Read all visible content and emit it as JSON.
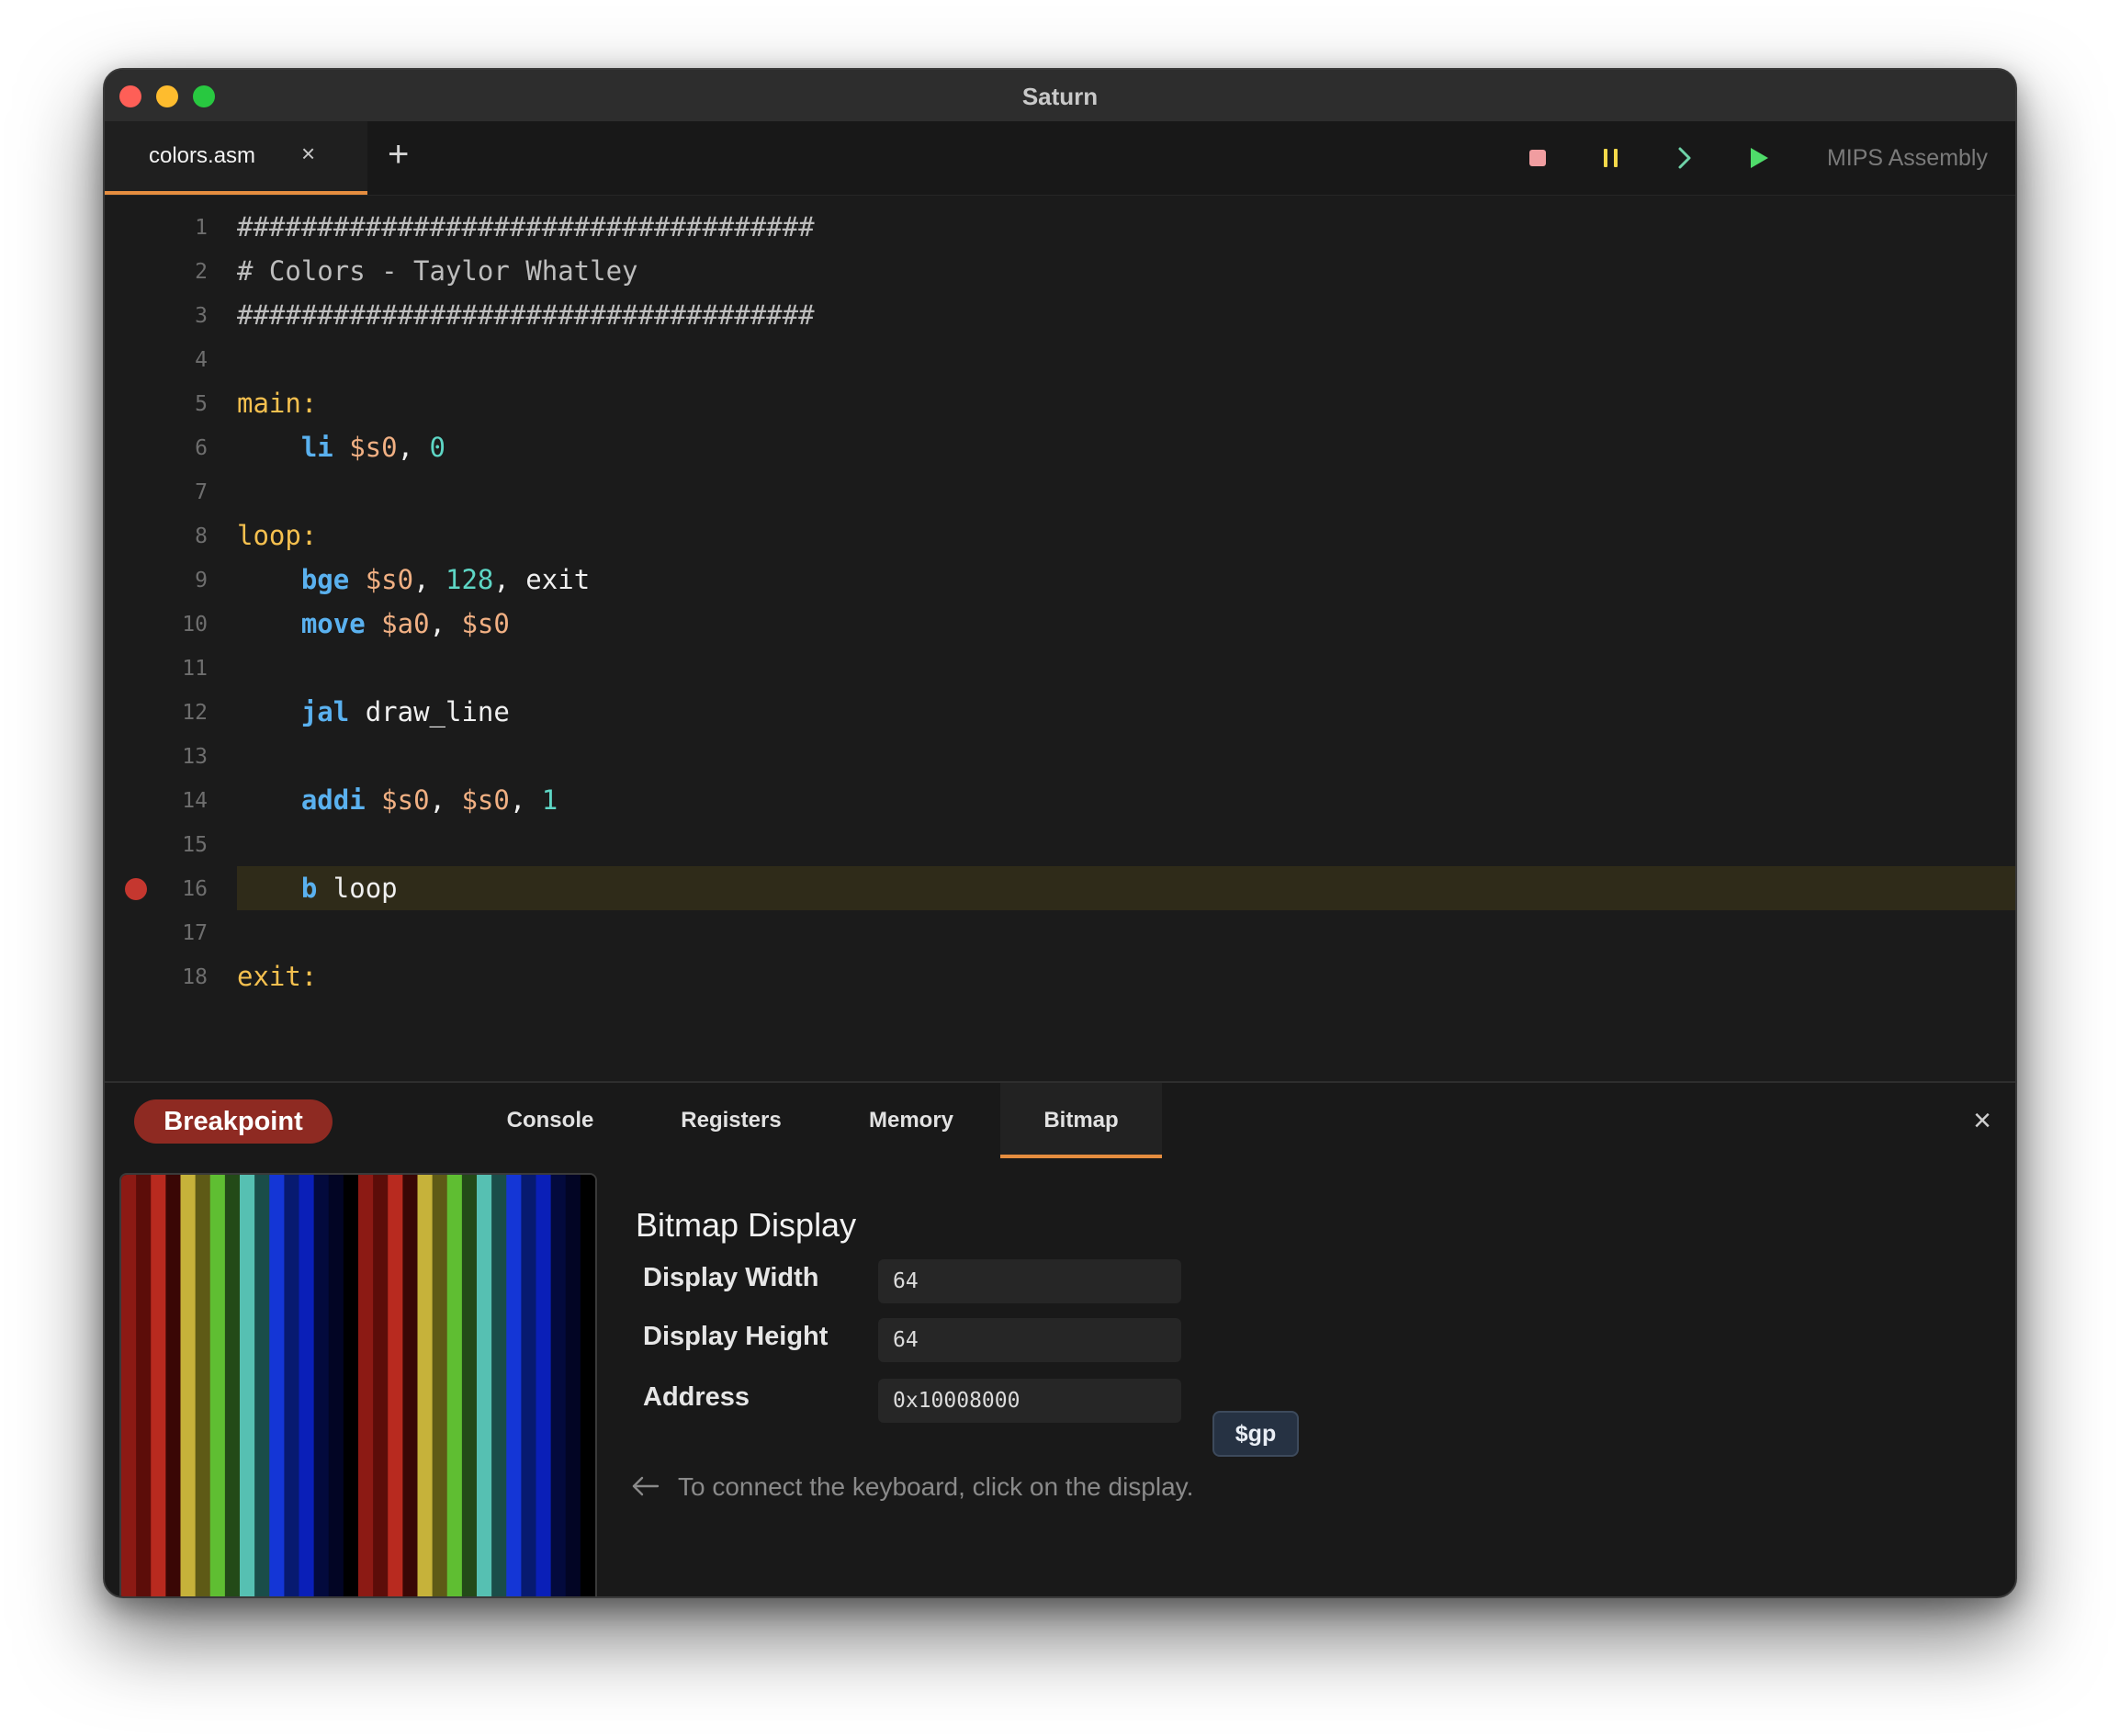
{
  "window": {
    "title": "Saturn"
  },
  "tabs": [
    {
      "label": "colors.asm",
      "close": "×"
    }
  ],
  "add_tab": "+",
  "toolbar": {
    "language": "MIPS Assembly"
  },
  "editor": {
    "lines": [
      {
        "num": "1",
        "tokens": [
          {
            "t": "####################################",
            "k": "comment"
          }
        ]
      },
      {
        "num": "2",
        "tokens": [
          {
            "t": "# Colors - Taylor Whatley",
            "k": "comment"
          }
        ]
      },
      {
        "num": "3",
        "tokens": [
          {
            "t": "####################################",
            "k": "comment"
          }
        ]
      },
      {
        "num": "4",
        "tokens": []
      },
      {
        "num": "5",
        "tokens": [
          {
            "t": "main:",
            "k": "label"
          }
        ]
      },
      {
        "num": "6",
        "tokens": [
          {
            "t": "    ",
            "k": "plain"
          },
          {
            "t": "li",
            "k": "instr"
          },
          {
            "t": " $s0",
            "k": "reg"
          },
          {
            "t": ", ",
            "k": "plain"
          },
          {
            "t": "0",
            "k": "num"
          }
        ]
      },
      {
        "num": "7",
        "tokens": []
      },
      {
        "num": "8",
        "tokens": [
          {
            "t": "loop:",
            "k": "label"
          }
        ]
      },
      {
        "num": "9",
        "tokens": [
          {
            "t": "    ",
            "k": "plain"
          },
          {
            "t": "bge",
            "k": "instr"
          },
          {
            "t": " $s0",
            "k": "reg"
          },
          {
            "t": ", ",
            "k": "plain"
          },
          {
            "t": "128",
            "k": "num"
          },
          {
            "t": ", exit",
            "k": "plain"
          }
        ]
      },
      {
        "num": "10",
        "tokens": [
          {
            "t": "    ",
            "k": "plain"
          },
          {
            "t": "move",
            "k": "instr"
          },
          {
            "t": " $a0",
            "k": "reg"
          },
          {
            "t": ", ",
            "k": "plain"
          },
          {
            "t": "$s0",
            "k": "reg"
          }
        ]
      },
      {
        "num": "11",
        "tokens": []
      },
      {
        "num": "12",
        "tokens": [
          {
            "t": "    ",
            "k": "plain"
          },
          {
            "t": "jal",
            "k": "instr"
          },
          {
            "t": " draw_line",
            "k": "plain"
          }
        ]
      },
      {
        "num": "13",
        "tokens": []
      },
      {
        "num": "14",
        "tokens": [
          {
            "t": "    ",
            "k": "plain"
          },
          {
            "t": "addi",
            "k": "instr"
          },
          {
            "t": " $s0",
            "k": "reg"
          },
          {
            "t": ", ",
            "k": "plain"
          },
          {
            "t": "$s0",
            "k": "reg"
          },
          {
            "t": ", ",
            "k": "plain"
          },
          {
            "t": "1",
            "k": "num"
          }
        ]
      },
      {
        "num": "15",
        "tokens": []
      },
      {
        "num": "16",
        "breakpoint": true,
        "highlight": true,
        "tokens": [
          {
            "t": "    ",
            "k": "plain"
          },
          {
            "t": "b",
            "k": "instr"
          },
          {
            "t": " loop",
            "k": "plain"
          }
        ]
      },
      {
        "num": "17",
        "tokens": []
      },
      {
        "num": "18",
        "tokens": [
          {
            "t": "exit:",
            "k": "label"
          }
        ]
      }
    ]
  },
  "bottom_panel": {
    "status_badge": "Breakpoint",
    "tabs": [
      {
        "label": "Console"
      },
      {
        "label": "Registers"
      },
      {
        "label": "Memory"
      },
      {
        "label": "Bitmap",
        "active": true
      }
    ],
    "close": "×"
  },
  "bitmap": {
    "title": "Bitmap Display",
    "width_label": "Display Width",
    "width_value": "64",
    "height_label": "Display Height",
    "height_value": "64",
    "address_label": "Address",
    "address_value": "0x10008000",
    "gp_button": "$gp",
    "hint": "To connect the keyboard, click on the display.",
    "stripe_colors": [
      "#8c1a14",
      "#5c0d09",
      "#b82a1f",
      "#3a0705",
      "#c6b23a",
      "#5e5a16",
      "#5fbe32",
      "#234a18",
      "#56c0b2",
      "#1a4d49",
      "#1436d6",
      "#071a70",
      "#0a1fb8",
      "#030a3d",
      "#020524",
      "#000000"
    ]
  },
  "colors": {
    "accent": "#e58d3f",
    "breakpoint": "#c5372f",
    "highlight_line": "#2f2b19"
  }
}
